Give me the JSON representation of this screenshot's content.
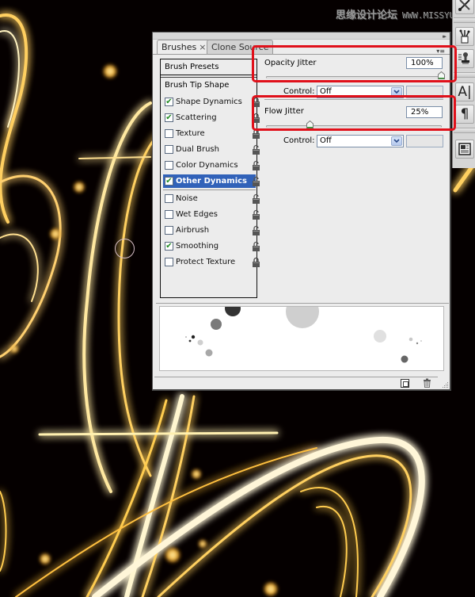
{
  "watermark": {
    "text_cn": "思缘设计论坛",
    "url": "WWW.MISSYUAN.COM"
  },
  "toolstrip": {
    "tools": [
      {
        "icon": "brush-scissors-icon",
        "name": "Tool Presets"
      },
      {
        "icon": "brush-pot-icon",
        "name": "Brushes"
      },
      {
        "icon": "clone-stamp-icon",
        "name": "Clone Source"
      },
      {
        "icon": "character-icon",
        "glyph": "A|",
        "name": "Character"
      },
      {
        "icon": "paragraph-icon",
        "glyph": "¶",
        "name": "Paragraph"
      },
      {
        "icon": "layer-comps-icon",
        "name": "Layer Comps"
      }
    ]
  },
  "panel": {
    "collapse_glyph": "▸▸",
    "menu_glyph": "▾≡",
    "tabs": [
      {
        "label": "Brushes",
        "close": "×",
        "active": true
      },
      {
        "label": "Clone Source",
        "active": false
      }
    ],
    "brush_presets_label": "Brush Presets",
    "brush_tip_shape_label": "Brush Tip Shape",
    "options": [
      {
        "label": "Shape Dynamics",
        "checked": true,
        "selected": false,
        "locked": true
      },
      {
        "label": "Scattering",
        "checked": true,
        "selected": false,
        "locked": true
      },
      {
        "label": "Texture",
        "checked": false,
        "selected": false,
        "locked": true
      },
      {
        "label": "Dual Brush",
        "checked": false,
        "selected": false,
        "locked": false
      },
      {
        "label": "Color Dynamics",
        "checked": false,
        "selected": false,
        "locked": false
      },
      {
        "label": "Other Dynamics",
        "checked": true,
        "selected": true,
        "locked": false
      },
      {
        "label": "Noise",
        "checked": false,
        "selected": false,
        "locked": false
      },
      {
        "label": "Wet Edges",
        "checked": false,
        "selected": false,
        "locked": false
      },
      {
        "label": "Airbrush",
        "checked": false,
        "selected": false,
        "locked": false
      },
      {
        "label": "Smoothing",
        "checked": true,
        "selected": false,
        "locked": false
      },
      {
        "label": "Protect Texture",
        "checked": false,
        "selected": false,
        "locked": true
      }
    ],
    "opacity_jitter": {
      "label": "Opacity Jitter",
      "value": "100%",
      "slider_fraction": 1.0,
      "control_label": "Control:",
      "control_value": "Off"
    },
    "flow_jitter": {
      "label": "Flow Jitter",
      "value": "25%",
      "slider_fraction": 0.25,
      "control_label": "Control:",
      "control_value": "Off"
    },
    "tick_glyph": "✔",
    "dropdown_glyph": "⌄"
  },
  "colors": {
    "highlight_red": "#e0101a",
    "selection_blue": "#3162b9",
    "panel_bg": "#ececec",
    "glow_gold": "#ffb020"
  }
}
